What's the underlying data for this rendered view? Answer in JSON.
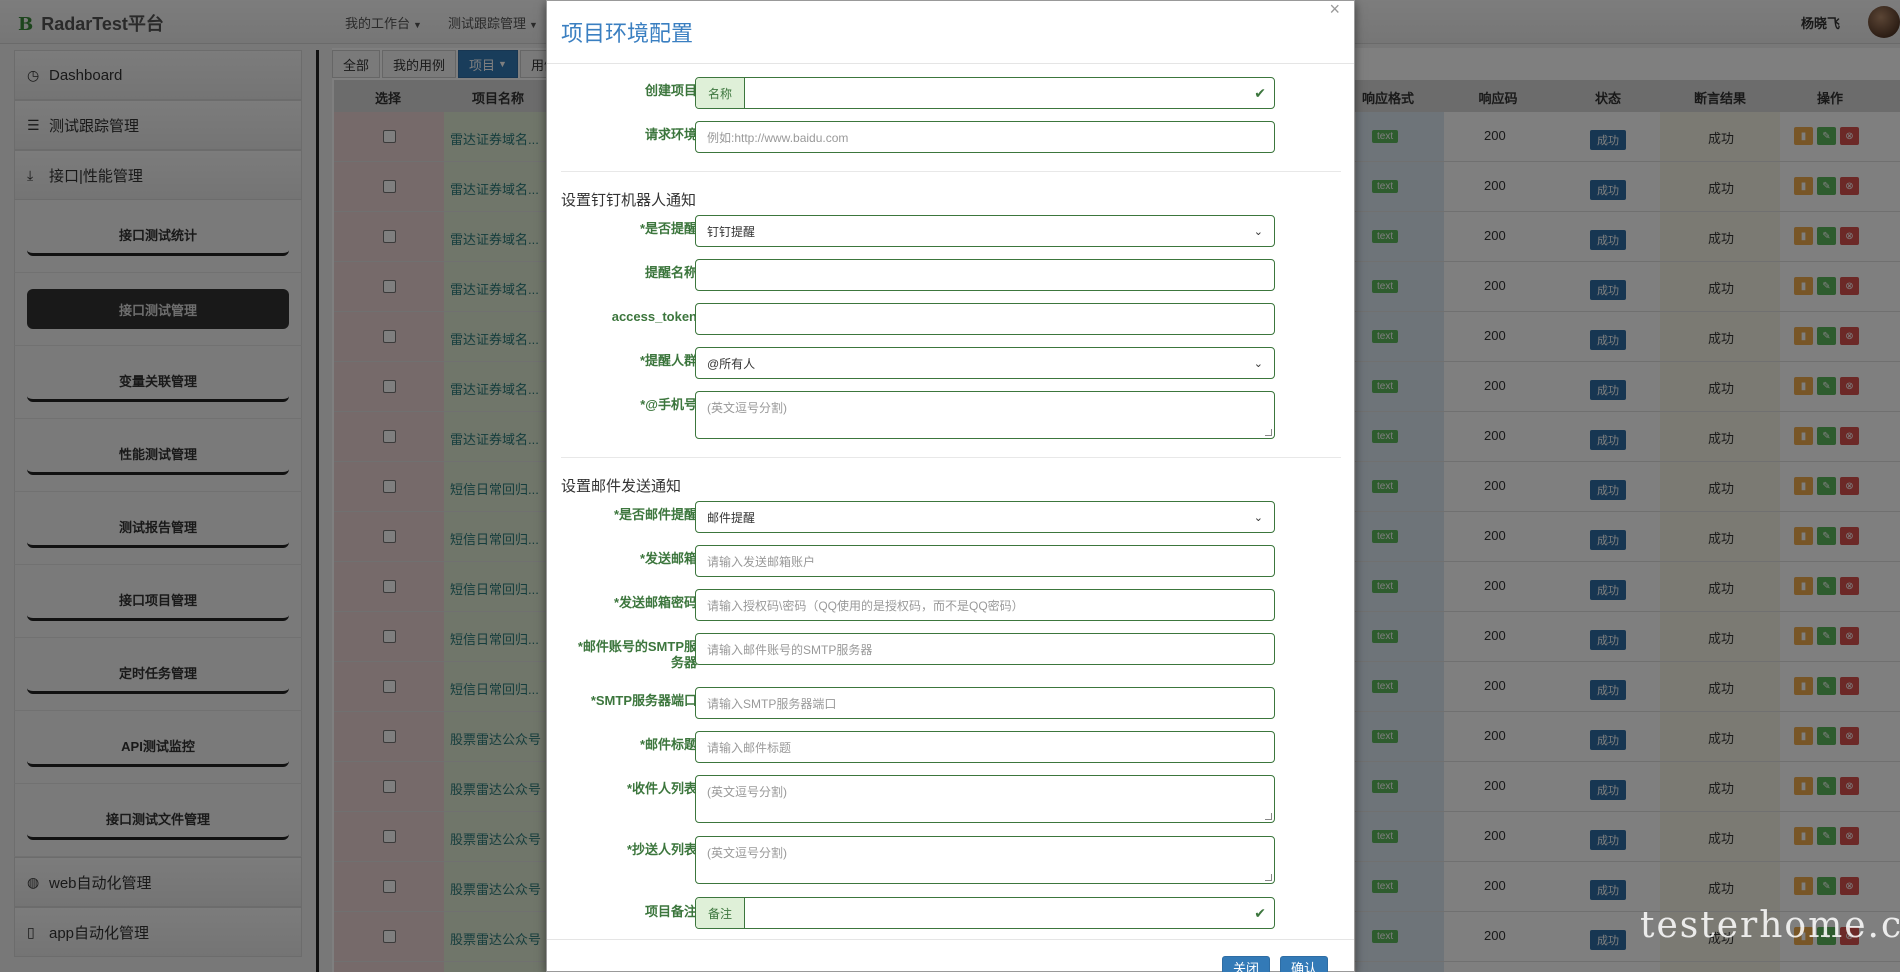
{
  "navbar": {
    "brand_letter": "B",
    "brand_name": "RadarTest平台",
    "menus": [
      "我的工作台",
      "测试跟踪管理"
    ],
    "user_name": "杨晓飞"
  },
  "sidebar": {
    "dashboard": "Dashboard",
    "test_tracking": "测试跟踪管理",
    "api_perf": "接口|性能管理",
    "sub_items": [
      "接口测试统计",
      "接口测试管理",
      "变量关联管理",
      "性能测试管理",
      "测试报告管理",
      "接口项目管理",
      "定时任务管理",
      "API测试监控",
      "接口测试文件管理"
    ],
    "web_auto": "web自动化管理",
    "app_auto": "app自动化管理"
  },
  "tabs": [
    "全部",
    "我的用例",
    "项目",
    "用例"
  ],
  "table": {
    "headers": {
      "select": "选择",
      "project": "项目名称",
      "format": "响应格式",
      "code": "响应码",
      "status": "状态",
      "assert": "断言结果",
      "ops": "操作"
    },
    "rows": [
      {
        "name": "雷达证券域名...",
        "format": "text",
        "code": "200",
        "status": "成功",
        "assert": "成功"
      },
      {
        "name": "雷达证券域名...",
        "format": "text",
        "code": "200",
        "status": "成功",
        "assert": "成功"
      },
      {
        "name": "雷达证券域名...",
        "format": "text",
        "code": "200",
        "status": "成功",
        "assert": "成功"
      },
      {
        "name": "雷达证券域名...",
        "format": "text",
        "code": "200",
        "status": "成功",
        "assert": "成功"
      },
      {
        "name": "雷达证券域名...",
        "format": "text",
        "code": "200",
        "status": "成功",
        "assert": "成功"
      },
      {
        "name": "雷达证券域名...",
        "format": "text",
        "code": "200",
        "status": "成功",
        "assert": "成功"
      },
      {
        "name": "雷达证券域名...",
        "format": "text",
        "code": "200",
        "status": "成功",
        "assert": "成功"
      },
      {
        "name": "短信日常回归...",
        "format": "text",
        "code": "200",
        "status": "成功",
        "assert": "成功"
      },
      {
        "name": "短信日常回归...",
        "format": "text",
        "code": "200",
        "status": "成功",
        "assert": "成功"
      },
      {
        "name": "短信日常回归...",
        "format": "text",
        "code": "200",
        "status": "成功",
        "assert": "成功"
      },
      {
        "name": "短信日常回归...",
        "format": "text",
        "code": "200",
        "status": "成功",
        "assert": "成功"
      },
      {
        "name": "短信日常回归...",
        "format": "text",
        "code": "200",
        "status": "成功",
        "assert": "成功"
      },
      {
        "name": "股票雷达公众号",
        "format": "text",
        "code": "200",
        "status": "成功",
        "assert": "成功"
      },
      {
        "name": "股票雷达公众号",
        "format": "text",
        "code": "200",
        "status": "成功",
        "assert": "成功"
      },
      {
        "name": "股票雷达公众号",
        "format": "text",
        "code": "200",
        "status": "成功",
        "assert": "成功"
      },
      {
        "name": "股票雷达公众号",
        "format": "text",
        "code": "200",
        "status": "成功",
        "assert": "成功"
      },
      {
        "name": "股票雷达公众号",
        "format": "text",
        "code": "200",
        "status": "成功",
        "assert": "成功"
      }
    ]
  },
  "modal": {
    "title": "项目环境配置",
    "close_symbol": "×",
    "create_project": {
      "label": "创建项目",
      "addon": "名称",
      "value": ""
    },
    "env": {
      "label": "请求环境",
      "placeholder": "例如:http://www.baidu.com"
    },
    "dingtalk_section": "设置钉钉机器人通知",
    "remind": {
      "label": "*是否提醒",
      "value": "钉钉提醒"
    },
    "remind_name": {
      "label": "提醒名称",
      "value": ""
    },
    "access_token": {
      "label": "access_token",
      "value": ""
    },
    "remind_group": {
      "label": "*提醒人群",
      "value": "@所有人"
    },
    "phone": {
      "label": "*@手机号",
      "placeholder": "(英文逗号分割)"
    },
    "mail_section": "设置邮件发送通知",
    "mail_remind": {
      "label": "*是否邮件提醒",
      "value": "邮件提醒"
    },
    "sender": {
      "label": "*发送邮箱",
      "placeholder": "请输入发送邮箱账户"
    },
    "sender_pwd": {
      "label": "*发送邮箱密码",
      "placeholder": "请输入授权码\\密码（QQ使用的是授权码，而不是QQ密码）"
    },
    "smtp_server": {
      "label": "*邮件账号的SMTP服务器",
      "placeholder": "请输入邮件账号的SMTP服务器"
    },
    "smtp_port": {
      "label": "*SMTP服务器端口",
      "placeholder": "请输入SMTP服务器端口"
    },
    "mail_subject": {
      "label": "*邮件标题",
      "placeholder": "请输入邮件标题"
    },
    "receivers": {
      "label": "*收件人列表",
      "placeholder": "(英文逗号分割)"
    },
    "cc": {
      "label": "*抄送人列表",
      "placeholder": "(英文逗号分割)"
    },
    "note": {
      "label": "项目备注",
      "addon": "备注",
      "value": ""
    },
    "close_button": "关闭",
    "confirm_button": "确认"
  },
  "watermark": "testerhome.com"
}
